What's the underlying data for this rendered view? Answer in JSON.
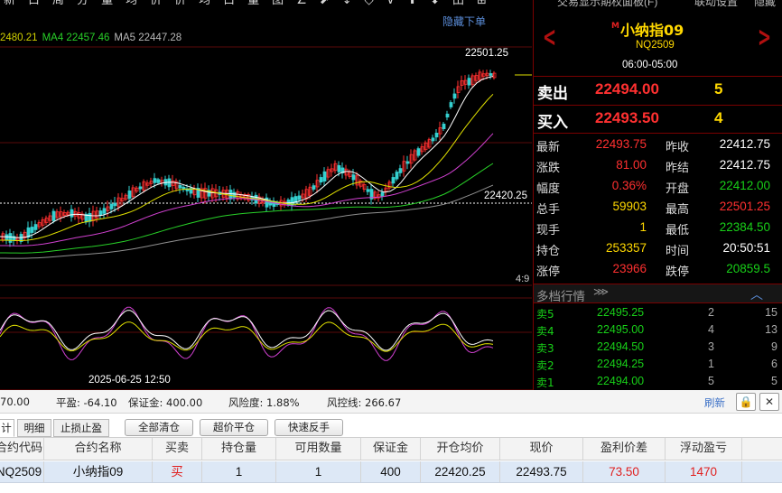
{
  "toolbar": {
    "icons": [
      "新",
      "白",
      "周",
      "分",
      "量",
      "均",
      "价",
      "价",
      "均",
      "白",
      "量",
      "图",
      "∠",
      "⬈",
      "↓",
      "◇",
      "∨",
      "⬆",
      "⬇",
      "田",
      "⊞"
    ],
    "hide_menu": "隐藏下单"
  },
  "chart": {
    "ma_legend": [
      {
        "text": "2480.21",
        "color": "#d0d000"
      },
      {
        "text": "MA4 22457.46",
        "color": "#28d028"
      },
      {
        "text": "MA5 22447.28",
        "color": "#b8b8b8"
      }
    ],
    "high_label": "22501.25",
    "avg_label": "22420.25",
    "ratio_label": "4:9",
    "time_label": "2025-06-25 12:50"
  },
  "panel": {
    "topbar": [
      "交易显示期权面板(F)",
      "联动设置",
      "隐藏"
    ],
    "title": "小纳指09",
    "title_badge": "M",
    "code": "NQ2509",
    "session": "06:00-05:00",
    "sell_label": "卖出",
    "sell_price": "22494.00",
    "sell_vol": "5",
    "buy_label": "买入",
    "buy_price": "22493.50",
    "buy_vol": "4",
    "quotes": [
      {
        "l1": "最新",
        "v1": "22493.75",
        "c1": "#ff3030",
        "l2": "昨收",
        "v2": "22412.75",
        "c2": "#ffffff"
      },
      {
        "l1": "涨跌",
        "v1": "81.00",
        "c1": "#ff3030",
        "l2": "昨结",
        "v2": "22412.75",
        "c2": "#ffffff"
      },
      {
        "l1": "幅度",
        "v1": "0.36%",
        "c1": "#ff3030",
        "l2": "开盘",
        "v2": "22412.00",
        "c2": "#18d018"
      },
      {
        "l1": "总手",
        "v1": "59903",
        "c1": "#ffd800",
        "l2": "最高",
        "v2": "22501.25",
        "c2": "#ff3030"
      },
      {
        "l1": "现手",
        "v1": "1",
        "c1": "#ffd800",
        "l2": "最低",
        "v2": "22384.50",
        "c2": "#18d018"
      },
      {
        "l1": "持仓",
        "v1": "253357",
        "c1": "#ffd800",
        "l2": "时间",
        "v2": "20:50:51",
        "c2": "#ffffff"
      },
      {
        "l1": "涨停",
        "v1": "23966",
        "c1": "#ff3030",
        "l2": "跌停",
        "v2": "20859.5",
        "c2": "#18d018"
      }
    ],
    "depth_title": "多档行情",
    "depth_icon": "⋙",
    "depth_collapse": "︿",
    "depth": [
      {
        "label": "卖5",
        "price": "22495.25",
        "vol": "2",
        "total": "15"
      },
      {
        "label": "卖4",
        "price": "22495.00",
        "vol": "4",
        "total": "13"
      },
      {
        "label": "卖3",
        "price": "22494.50",
        "vol": "3",
        "total": "9"
      },
      {
        "label": "卖2",
        "price": "22494.25",
        "vol": "1",
        "total": "6"
      },
      {
        "label": "卖1",
        "price": "22494.00",
        "vol": "5",
        "total": "5"
      }
    ]
  },
  "status": {
    "equity_tail": "70.00",
    "close_pl": "平盈: -64.10",
    "margin": "保证金: 400.00",
    "risk": "风险度: 1.88%",
    "risk_line": "风控线: 266.67",
    "refresh": "刷新",
    "lock_icon": "🔒",
    "close_icon": "✕"
  },
  "tabs": [
    "计",
    "明细",
    "止损止盈"
  ],
  "actions": [
    "全部清仓",
    "超价平仓",
    "快速反手"
  ],
  "positions": {
    "columns": [
      "合约代码",
      "合约名称",
      "买卖",
      "持仓量",
      "可用数量",
      "保证金",
      "开仓均价",
      "现价",
      "盈利价差",
      "浮动盈亏"
    ],
    "rows": [
      [
        "NQ2509",
        "小纳指09",
        "买",
        "1",
        "1",
        "400",
        "22420.25",
        "22493.75",
        "73.50",
        "1470"
      ]
    ]
  },
  "colors": {
    "up": "#ff3030",
    "down": "#18d018",
    "accent_yellow": "#ffd800",
    "border_red": "#7a0000"
  }
}
